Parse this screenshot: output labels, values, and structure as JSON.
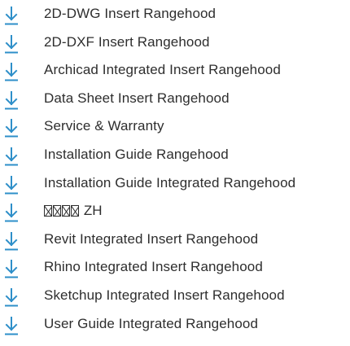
{
  "theme": {
    "accent_color": "#2e8fc9",
    "text_color": "#2e2e2e"
  },
  "downloads": {
    "icon": "download-arrow-icon",
    "items": [
      {
        "label": "2D-DWG Insert Rangehood"
      },
      {
        "label": "2D-DXF Insert Rangehood"
      },
      {
        "label": "Archicad Integrated Insert Rangehood"
      },
      {
        "label": "Data Sheet Insert Rangehood"
      },
      {
        "label": "Service & Warranty"
      },
      {
        "label": "Installation Guide Rangehood"
      },
      {
        "label": "Installation Guide Integrated Rangehood"
      },
      {
        "label": "ZH",
        "unrendered_glyphs": 4
      },
      {
        "label": "Revit Integrated Insert Rangehood"
      },
      {
        "label": "Rhino Integrated Insert Rangehood"
      },
      {
        "label": "Sketchup Integrated Insert Rangehood"
      },
      {
        "label": "User Guide Integrated Rangehood"
      }
    ]
  }
}
